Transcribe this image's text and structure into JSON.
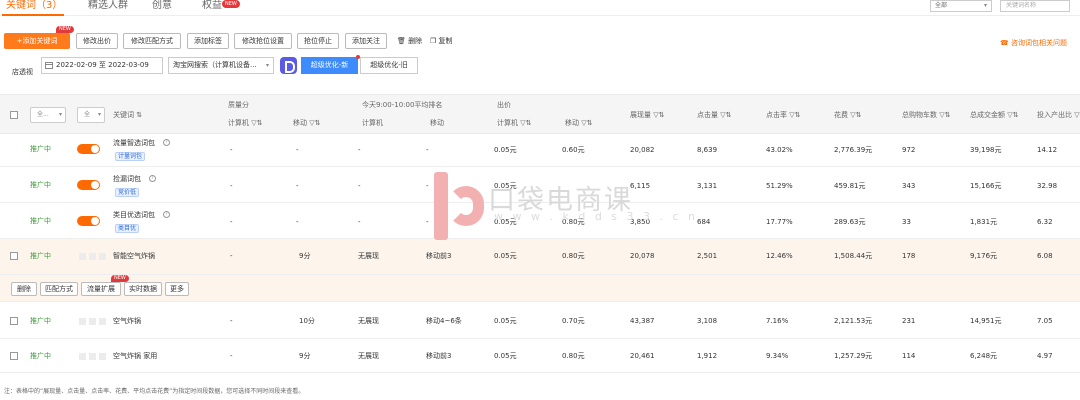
{
  "tabs": [
    {
      "label": "关键词（3）",
      "active": true
    },
    {
      "label": "精选人群",
      "active": false
    },
    {
      "label": "创意",
      "active": false
    },
    {
      "label": "权益",
      "active": false,
      "badge": "NEW"
    }
  ],
  "top_right": {
    "select_value": "全部",
    "search_placeholder": "关键词名称"
  },
  "toolbar": {
    "add_keyword": "+添加关键词",
    "add_keyword_badge": "NEW",
    "modify_bid": "修改出价",
    "modify_match": "修改匹配方式",
    "add_label": "添加标签",
    "modify_position": "修改抢位设置",
    "stop_position": "抢位停止",
    "add_follow": "添加关注",
    "delete": "删除",
    "copy": "复制",
    "consult": "咨询词包相关问题"
  },
  "filters": {
    "label": "店透视",
    "date_start": "2022-02-09",
    "date_sep": "至",
    "date_end": "2022-03-09",
    "site_select": "淘宝网搜索（计算机设备...",
    "opt_new": "超级优化-新",
    "opt_old": "超级优化-旧"
  },
  "table": {
    "status_filter": "全...",
    "switch_filter": "全",
    "headers": {
      "keyword": "关键词 ⇅",
      "quality": "质量分",
      "quality_pc": "计算机 ▽⇅",
      "quality_mobile": "移动 ▽⇅",
      "rank": "今天9:00-10:00平均排名",
      "rank_pc": "计算机",
      "rank_mobile": "移动",
      "bid": "出价",
      "bid_pc": "计算机 ▽⇅",
      "bid_mobile": "移动 ▽⇅",
      "impressions": "展现量 ▽⇅",
      "clicks": "点击量 ▽⇅",
      "ctr": "点击率 ▽⇅",
      "cost": "花费 ▽⇅",
      "cart": "总购物车数 ▽⇅",
      "gmv": "总成交金额 ▽⇅",
      "roi": "投入产出比 ▽"
    },
    "rows": [
      {
        "status": "推广中",
        "keyword": "流量智选词包",
        "tag": "计量词包",
        "quality_pc": "-",
        "quality_mobile": "-",
        "rank_pc": "-",
        "rank_mobile": "-",
        "bid_pc": "0.05元",
        "bid_mobile": "0.60元",
        "impressions": "20,082",
        "clicks": "8,639",
        "ctr": "43.02%",
        "cost": "2,776.39元",
        "cart": "972",
        "gmv": "39,198元",
        "roi": "14.12"
      },
      {
        "status": "推广中",
        "keyword": "捡漏词包",
        "tag": "竞价低",
        "quality_pc": "-",
        "quality_mobile": "-",
        "rank_pc": "-",
        "rank_mobile": "-",
        "bid_pc": "0.05元",
        "bid_mobile": "",
        "impressions": "6,115",
        "clicks": "3,131",
        "ctr": "51.29%",
        "cost": "459.81元",
        "cart": "343",
        "gmv": "15,166元",
        "roi": "32.98"
      },
      {
        "status": "推广中",
        "keyword": "类目优选词包",
        "tag": "类目优",
        "quality_pc": "-",
        "quality_mobile": "-",
        "rank_pc": "-",
        "rank_mobile": "-",
        "bid_pc": "0.05元",
        "bid_mobile": "0.80元",
        "impressions": "3,850",
        "clicks": "684",
        "ctr": "17.77%",
        "cost": "289.63元",
        "cart": "33",
        "gmv": "1,831元",
        "roi": "6.32"
      },
      {
        "status": "推广中",
        "keyword": "智能空气炸锅",
        "tag": "",
        "quality_pc": "-",
        "quality_mobile": "9分",
        "rank_pc": "无展现",
        "rank_mobile": "移动前3",
        "bid_pc": "0.05元",
        "bid_mobile": "0.80元",
        "impressions": "20,078",
        "clicks": "2,501",
        "ctr": "12.46%",
        "cost": "1,508.44元",
        "cart": "178",
        "gmv": "9,176元",
        "roi": "6.08"
      },
      {
        "status": "推广中",
        "keyword": "空气炸锅",
        "tag": "",
        "quality_pc": "-",
        "quality_mobile": "10分",
        "rank_pc": "无展现",
        "rank_mobile": "移动4~6条",
        "bid_pc": "0.05元",
        "bid_mobile": "0.70元",
        "impressions": "43,387",
        "clicks": "3,108",
        "ctr": "7.16%",
        "cost": "2,121.53元",
        "cart": "231",
        "gmv": "14,951元",
        "roi": "7.05"
      },
      {
        "status": "推广中",
        "keyword": "空气炸锅 家用",
        "tag": "",
        "quality_pc": "-",
        "quality_mobile": "9分",
        "rank_pc": "无展现",
        "rank_mobile": "移动前3",
        "bid_pc": "0.05元",
        "bid_mobile": "0.80元",
        "impressions": "20,461",
        "clicks": "1,912",
        "ctr": "9.34%",
        "cost": "1,257.29元",
        "cart": "114",
        "gmv": "6,248元",
        "roi": "4.97"
      }
    ],
    "row_actions": {
      "delete": "删除",
      "match": "匹配方式",
      "expand": "流量扩展",
      "expand_badge": "NEW",
      "realtime": "实时数据",
      "more": "更多"
    }
  },
  "footnote": "注：表格中的“展现量、点击量、点击率、花费、平均点击花费”为指定时间段数据，您可选择不同时间段来查看。",
  "watermark": {
    "title": "口袋电商课",
    "subtitle": "w w w . k d d s 3 3 . c n"
  },
  "colors": {
    "accent": "#ff6a00",
    "status_green": "#3a9c36",
    "link_blue": "#3d8bfd",
    "badge_red": "#e4393c"
  }
}
